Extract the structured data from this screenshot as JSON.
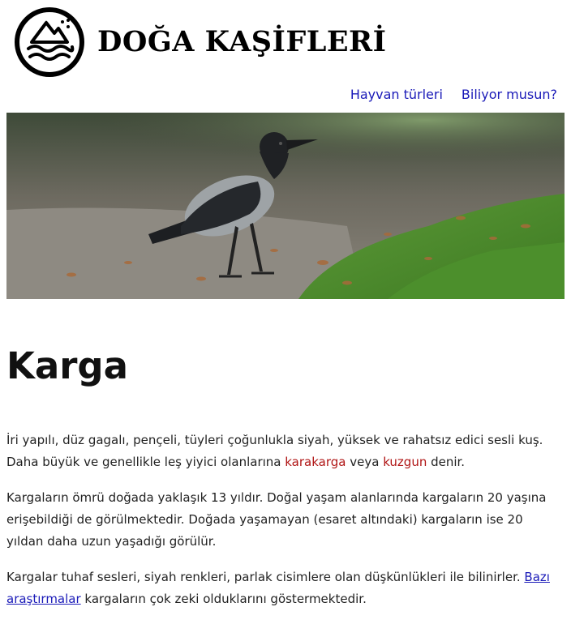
{
  "site": {
    "title": "DOĞA KAŞİFLERİ",
    "logo_icon": "mountain-wave-logo-icon"
  },
  "nav": {
    "items": [
      {
        "label": "Hayvan türleri"
      },
      {
        "label": "Biliyor musun?"
      }
    ]
  },
  "hero": {
    "image_icon": "crow-photo-image"
  },
  "article": {
    "title": "Karga",
    "p1": {
      "text_a": "İri yapılı, düz gagalı, pençeli, tüyleri çoğunlukla siyah, yüksek ve rahatsız edici sesli kuş. Daha büyük ve genellikle leş yiyici olanlarına ",
      "link_a": "karakarga",
      "text_b": " veya ",
      "link_b": "kuzgun",
      "text_c": " denir."
    },
    "p2": "Kargaların ömrü doğada yaklaşık 13 yıldır. Doğal yaşam alanlarında kargaların 20 yaşına erişebildiği de görülmektedir. Doğada yaşamayan (esaret altındaki) kargaların ise 20 yıldan daha uzun yaşadığı görülür.",
    "p3": {
      "text_a": "Kargalar tuhaf sesleri, siyah renkleri, parlak cisimlere olan düşkünlükleri ile bilinirler. ",
      "link": "Bazı araştırmalar",
      "text_b": " kargaların çok zeki olduklarını göstermektedir."
    }
  },
  "colors": {
    "nav_link": "#1a1ab8",
    "inline_link_red": "#b01515",
    "grass": "#4f8a2e",
    "ground": "#8f8a80"
  }
}
